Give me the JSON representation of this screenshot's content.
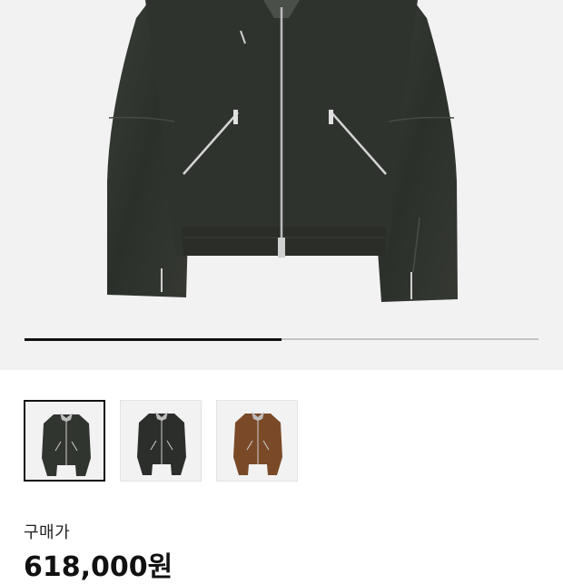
{
  "product": {
    "price_label": "구매가",
    "price_value": "618,000원"
  },
  "gallery": {
    "image_subject": "jacket-photo",
    "slide_progress": 0.5,
    "jacket_color": "#2f332e",
    "thumbnails": [
      {
        "name": "thumbnail-1",
        "color": "#31352f",
        "selected": true
      },
      {
        "name": "thumbnail-2",
        "color": "#2b2e2a",
        "selected": false
      },
      {
        "name": "thumbnail-3",
        "color": "#7a4a28",
        "selected": false
      }
    ]
  },
  "colors": {
    "hero_bg": "#f2f2f2",
    "progress_track": "#c4c4c4",
    "progress_fill": "#111111",
    "text_primary": "#111111"
  }
}
